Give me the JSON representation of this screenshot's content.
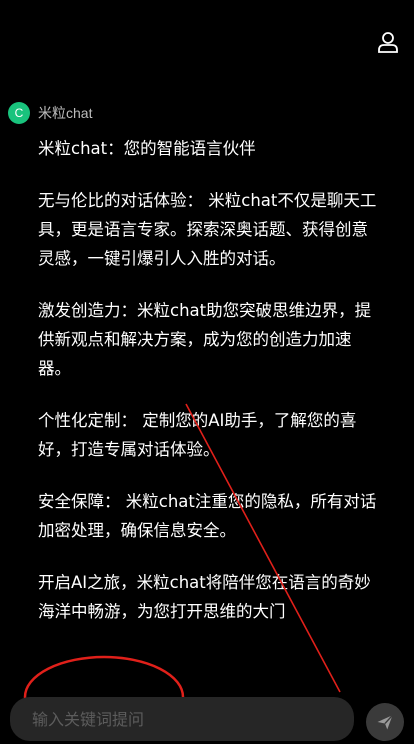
{
  "header": {
    "user_icon": "user-icon"
  },
  "bot": {
    "avatar_letter": "C",
    "name": "米粒chat",
    "avatar_color": "#19c37d"
  },
  "message": {
    "paragraphs": [
      "米粒chat：您的智能语言伙伴",
      " 无与伦比的对话体验： 米粒chat不仅是聊天工具，更是语言专家。探索深奥话题、获得创意灵感，一键引爆引人入胜的对话。",
      " 激发创造力：米粒chat助您突破思维边界，提供新观点和解决方案，成为您的创造力加速器。",
      " 个性化定制： 定制您的AI助手，了解您的喜好，打造专属对话体验。",
      " 安全保障： 米粒chat注重您的隐私，所有对话加密处理，确保信息安全。",
      "开启AI之旅，米粒chat将陪伴您在语言的奇妙海洋中畅游，为您打开思维的大门"
    ]
  },
  "input": {
    "placeholder": "输入关键词提问",
    "value": ""
  },
  "send": {
    "icon": "send-icon"
  },
  "annotation": {
    "color": "#e0201a"
  }
}
